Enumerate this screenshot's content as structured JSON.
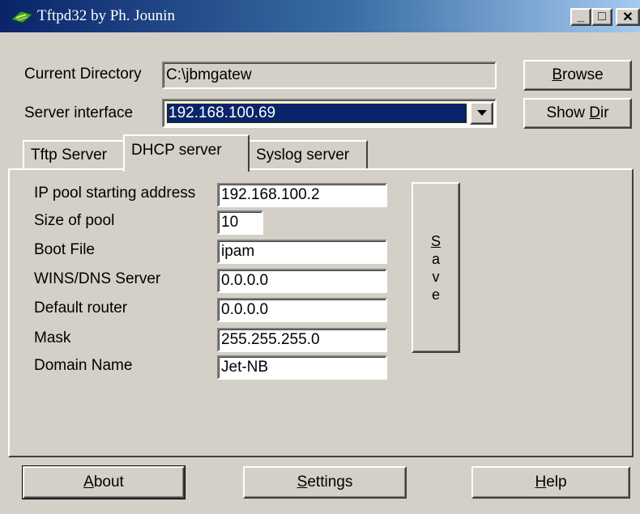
{
  "window": {
    "title": "Tftpd32 by Ph. Jounin",
    "minimize_label": "_",
    "maximize_label": "□",
    "close_label": "✕"
  },
  "directory": {
    "label": "Current Directory",
    "value": "C:\\jbmgatew",
    "browse_label": "Browse",
    "browse_key": "B",
    "browse_rest": "rowse"
  },
  "interface": {
    "label": "Server interface",
    "value": "192.168.100.69",
    "show_dir_prefix": "Show ",
    "show_dir_key": "D",
    "show_dir_rest": "ir"
  },
  "tabs": [
    {
      "label": "Tftp Server",
      "active": false
    },
    {
      "label": "DHCP server",
      "active": true
    },
    {
      "label": "Syslog server",
      "active": false
    }
  ],
  "dhcp": {
    "fields": [
      {
        "label": "IP pool starting address",
        "value": "192.168.100.2"
      },
      {
        "label": "Size of pool",
        "value": "10"
      },
      {
        "label": "Boot File",
        "value": "ipam"
      },
      {
        "label": "WINS/DNS Server",
        "value": "0.0.0.0"
      },
      {
        "label": "Default router",
        "value": "0.0.0.0"
      },
      {
        "label": "Mask",
        "value": "255.255.255.0"
      },
      {
        "label": "Domain Name",
        "value": "Jet-NB"
      }
    ],
    "save_letters": [
      "S",
      "a",
      "v",
      "e"
    ]
  },
  "footer": {
    "about_key": "A",
    "about_rest": "bout",
    "settings_key": "S",
    "settings_rest": "ettings",
    "help_key": "H",
    "help_rest": "elp"
  },
  "colors": {
    "face": "#d4d0c8",
    "title_start": "#0a246a",
    "title_end": "#a6caf0",
    "selection": "#0a246a"
  },
  "icons": {
    "app": "tftpd-app-icon",
    "dropdown": "dropdown-arrow-icon"
  }
}
